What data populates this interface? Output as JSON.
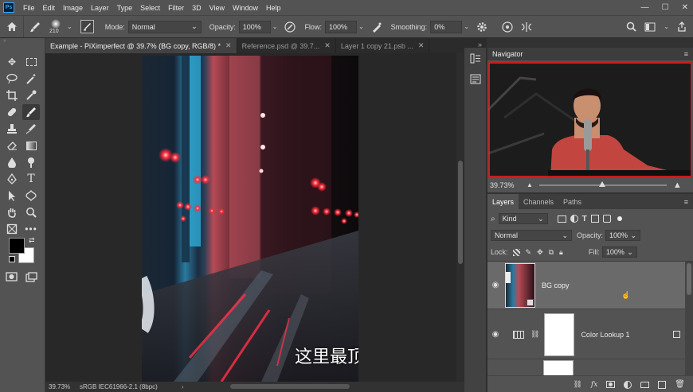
{
  "app": {
    "logo": "Ps"
  },
  "menubar": {
    "items": [
      "File",
      "Edit",
      "Image",
      "Layer",
      "Type",
      "Select",
      "Filter",
      "3D",
      "View",
      "Window",
      "Help"
    ],
    "window_controls": [
      "—",
      "☐",
      "✕"
    ]
  },
  "options": {
    "brush_size": "210",
    "mode_label": "Mode:",
    "mode_value": "Normal",
    "opacity_label": "Opacity:",
    "opacity_value": "100%",
    "flow_label": "Flow:",
    "flow_value": "100%",
    "smoothing_label": "Smoothing:",
    "smoothing_value": "0%"
  },
  "tabs": [
    {
      "label": "Example - PiXimperfect @ 39.7% (BG copy, RGB/8) *",
      "active": true
    },
    {
      "label": "Reference.psd @ 39.7...",
      "active": false
    },
    {
      "label": "Layer 1 copy 21.psb ...",
      "active": false
    }
  ],
  "canvas": {
    "subtitle": "这里最顶层"
  },
  "status": {
    "zoom": "39.73%",
    "profile": "sRGB IEC61966-2.1 (8bpc)",
    "arrow": "›"
  },
  "navigator": {
    "title": "Navigator",
    "zoom": "39.73%"
  },
  "layers": {
    "tabs": [
      "Layers",
      "Channels",
      "Paths"
    ],
    "filter_kind": "Kind",
    "blend_mode": "Normal",
    "opacity_label": "Opacity:",
    "opacity_value": "100%",
    "lock_label": "Lock:",
    "fill_label": "Fill:",
    "fill_value": "100%",
    "items": [
      {
        "name": "BG copy",
        "selected": true
      },
      {
        "name": "Color Lookup 1",
        "selected": false
      },
      {
        "name": "",
        "selected": false
      }
    ]
  },
  "colors": {
    "accent": "#31a8ff",
    "foreground": "#000000",
    "background": "#ffffff"
  }
}
